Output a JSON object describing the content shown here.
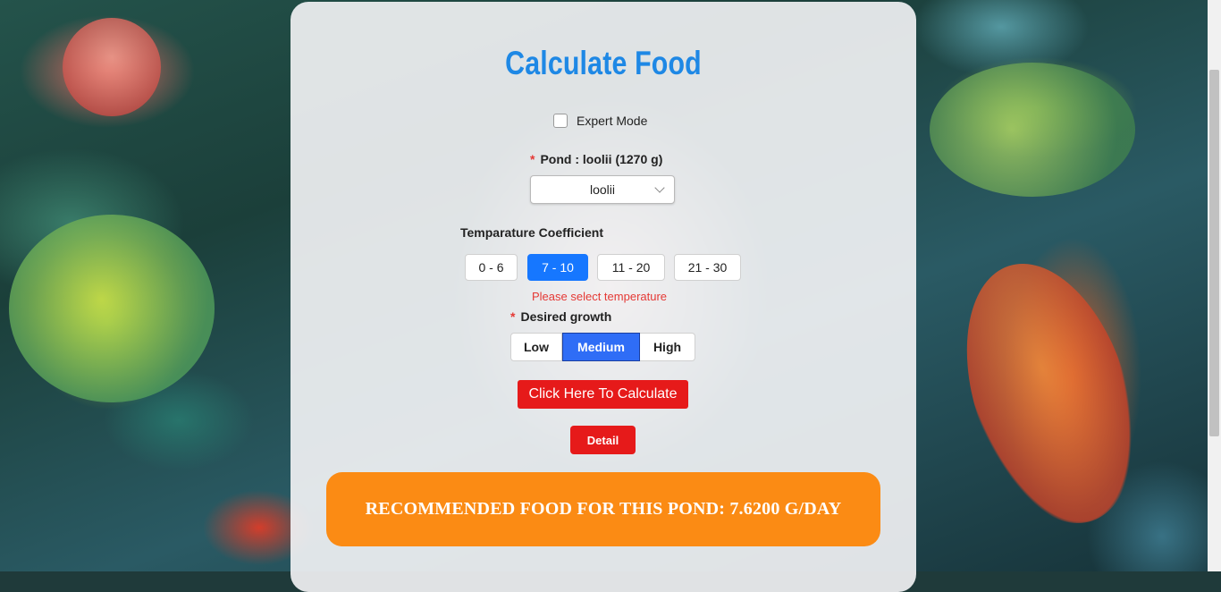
{
  "page": {
    "title": "Calculate Food",
    "expert_mode_label": "Expert Mode"
  },
  "pond": {
    "label": "Pond : loolii (1270 g)",
    "selected": "loolii"
  },
  "temperature": {
    "label": "Temparature Coefficient",
    "options": [
      "0 - 6",
      "7 - 10",
      "11 - 20",
      "21 - 30"
    ],
    "selected": "7 - 10",
    "error": "Please select temperature"
  },
  "growth": {
    "label": "Desired growth",
    "options": [
      "Low",
      "Medium",
      "High"
    ],
    "selected": "Medium"
  },
  "actions": {
    "calculate": "Click Here To Calculate",
    "detail": "Detail"
  },
  "result": {
    "text": "RECOMMENDED FOOD FOR THIS POND: 7.6200 G/DAY"
  },
  "colors": {
    "title": "#1e88e5",
    "primary": "#1677ff",
    "danger": "#e61a1a",
    "result": "#fb8b14"
  }
}
